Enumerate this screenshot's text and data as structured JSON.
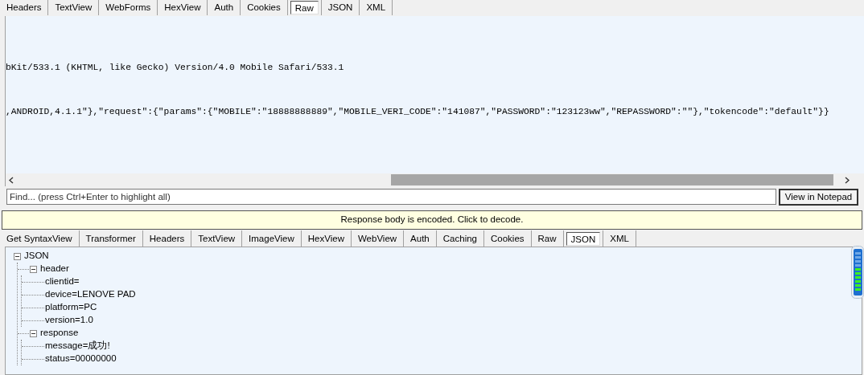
{
  "request_tabs": [
    {
      "label": "Headers",
      "selected": false
    },
    {
      "label": "TextView",
      "selected": false
    },
    {
      "label": "WebForms",
      "selected": false
    },
    {
      "label": "HexView",
      "selected": false
    },
    {
      "label": "Auth",
      "selected": false
    },
    {
      "label": "Cookies",
      "selected": false
    },
    {
      "label": "Raw",
      "selected": true
    },
    {
      "label": "JSON",
      "selected": false
    },
    {
      "label": "XML",
      "selected": false
    }
  ],
  "raw_lines": [
    "bKit/533.1 (KHTML, like Gecko) Version/4.0 Mobile Safari/533.1",
    ",ANDROID,4.1.1\"},\"request\":{\"params\":{\"MOBILE\":\"18888888889\",\"MOBILE_VERI_CODE\":\"141087\",\"PASSWORD\":\"123123ww\",\"REPASSWORD\":\"\"},\"tokencode\":\"default\"}}"
  ],
  "find": {
    "placeholder": "Find... (press Ctrl+Enter to highlight all)"
  },
  "view_button": "View in Notepad",
  "decode_banner": "Response body is encoded. Click to decode.",
  "response_tabs": [
    {
      "label": "Get SyntaxView",
      "selected": false
    },
    {
      "label": "Transformer",
      "selected": false
    },
    {
      "label": "Headers",
      "selected": false
    },
    {
      "label": "TextView",
      "selected": false
    },
    {
      "label": "ImageView",
      "selected": false
    },
    {
      "label": "HexView",
      "selected": false
    },
    {
      "label": "WebView",
      "selected": false
    },
    {
      "label": "Auth",
      "selected": false
    },
    {
      "label": "Caching",
      "selected": false
    },
    {
      "label": "Cookies",
      "selected": false
    },
    {
      "label": "Raw",
      "selected": false
    },
    {
      "label": "JSON",
      "selected": true
    },
    {
      "label": "XML",
      "selected": false
    }
  ],
  "tree": [
    {
      "label": "JSON",
      "expanded": true,
      "children": [
        {
          "label": "header",
          "expanded": true,
          "children": [
            {
              "label": "clientid="
            },
            {
              "label": "device=LENOVE PAD"
            },
            {
              "label": "platform=PC"
            },
            {
              "label": "version=1.0"
            }
          ]
        },
        {
          "label": "response",
          "expanded": true,
          "children": [
            {
              "label": "message=成功!"
            },
            {
              "label": "status=00000000"
            }
          ]
        }
      ]
    }
  ]
}
